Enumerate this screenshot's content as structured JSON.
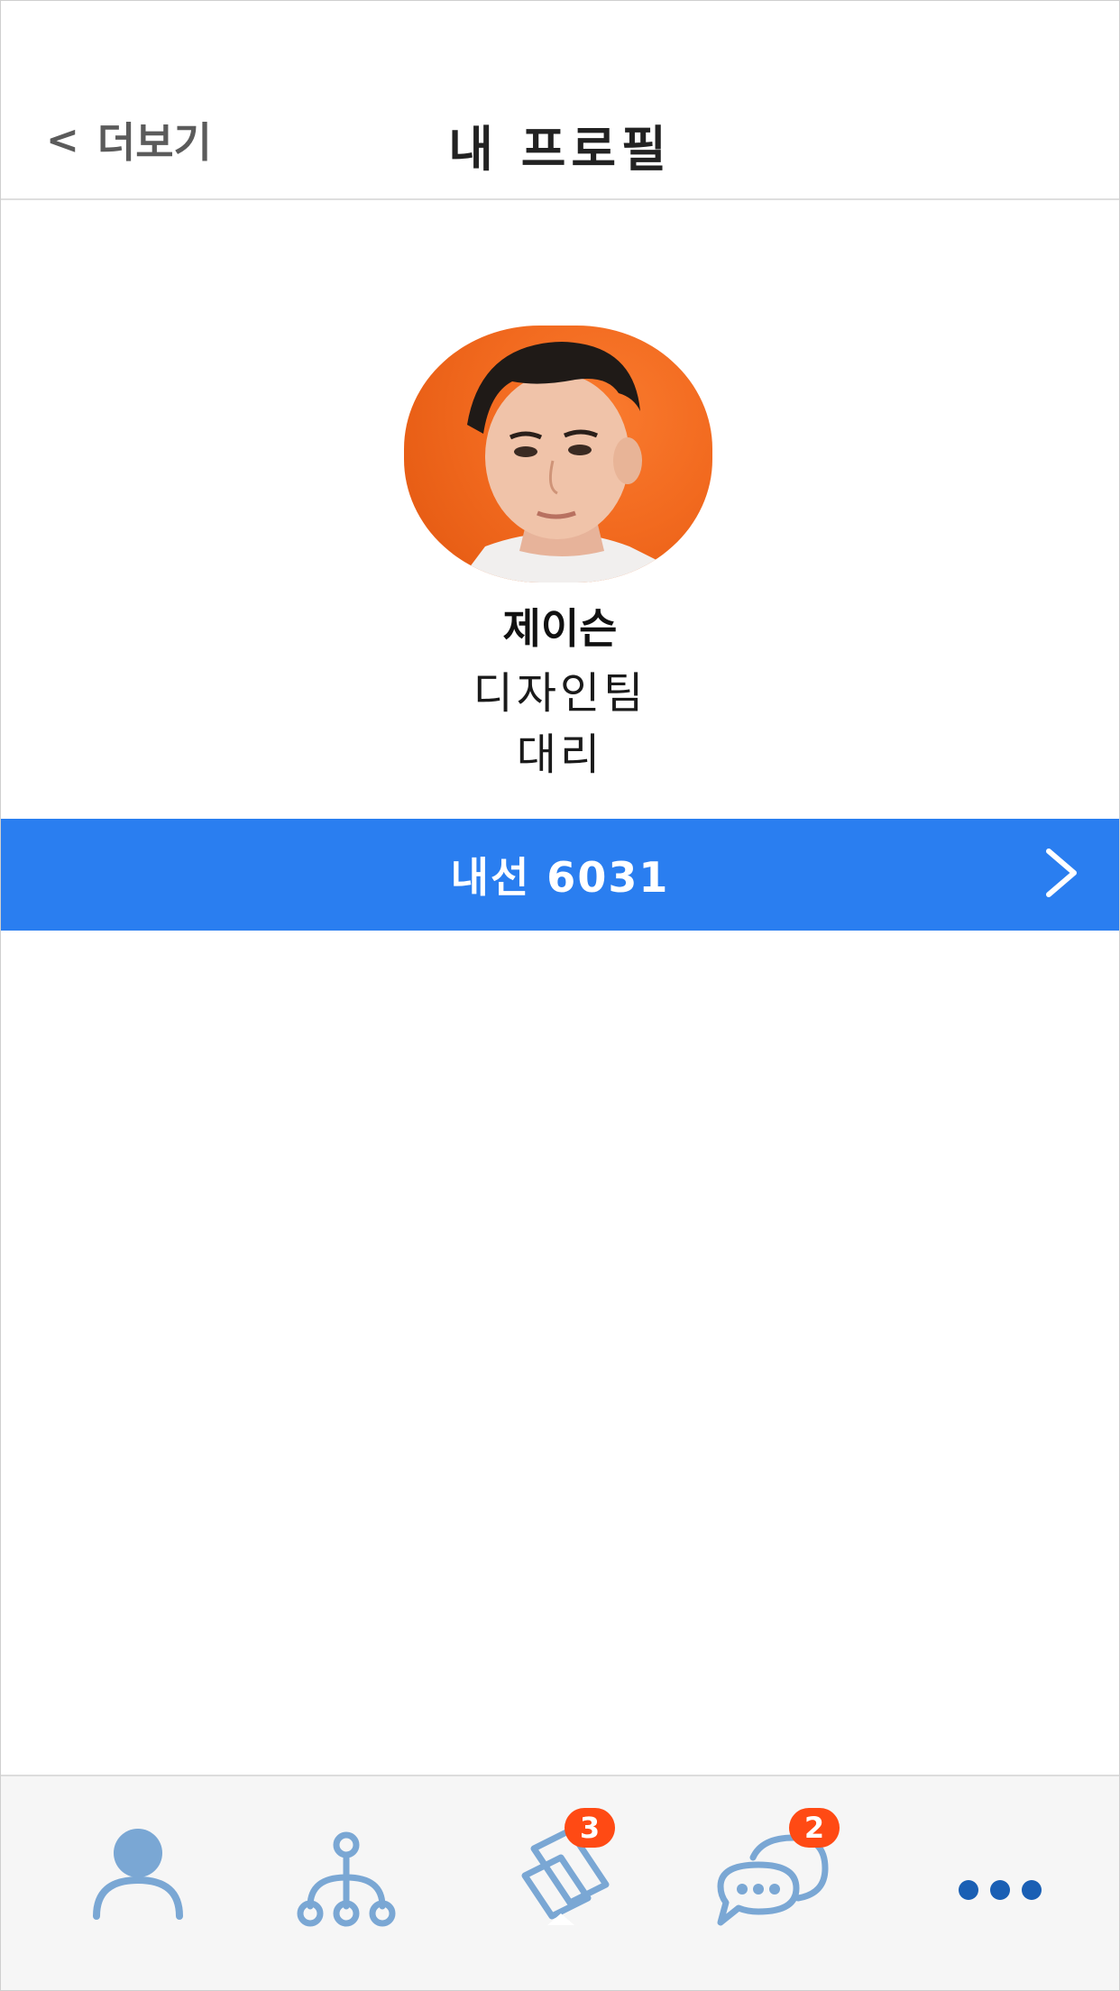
{
  "header": {
    "back_label": "더보기",
    "back_chevron": "<",
    "title": "내 프로필"
  },
  "profile": {
    "name": "제이슨",
    "team": "디자인팀",
    "rank": "대리"
  },
  "extension": {
    "label": "내선 6031"
  },
  "tabbar": {
    "tabs": [
      {
        "icon": "person-icon"
      },
      {
        "icon": "org-chart-icon"
      },
      {
        "icon": "notes-icon",
        "badge": "3"
      },
      {
        "icon": "chat-icon",
        "badge": "2"
      },
      {
        "icon": "more-icon"
      }
    ]
  },
  "colors": {
    "accent": "#2a7ef0",
    "badge": "#ff4a14",
    "tab_icon": "#7aa7d4",
    "more_icon": "#1a5fb4"
  }
}
